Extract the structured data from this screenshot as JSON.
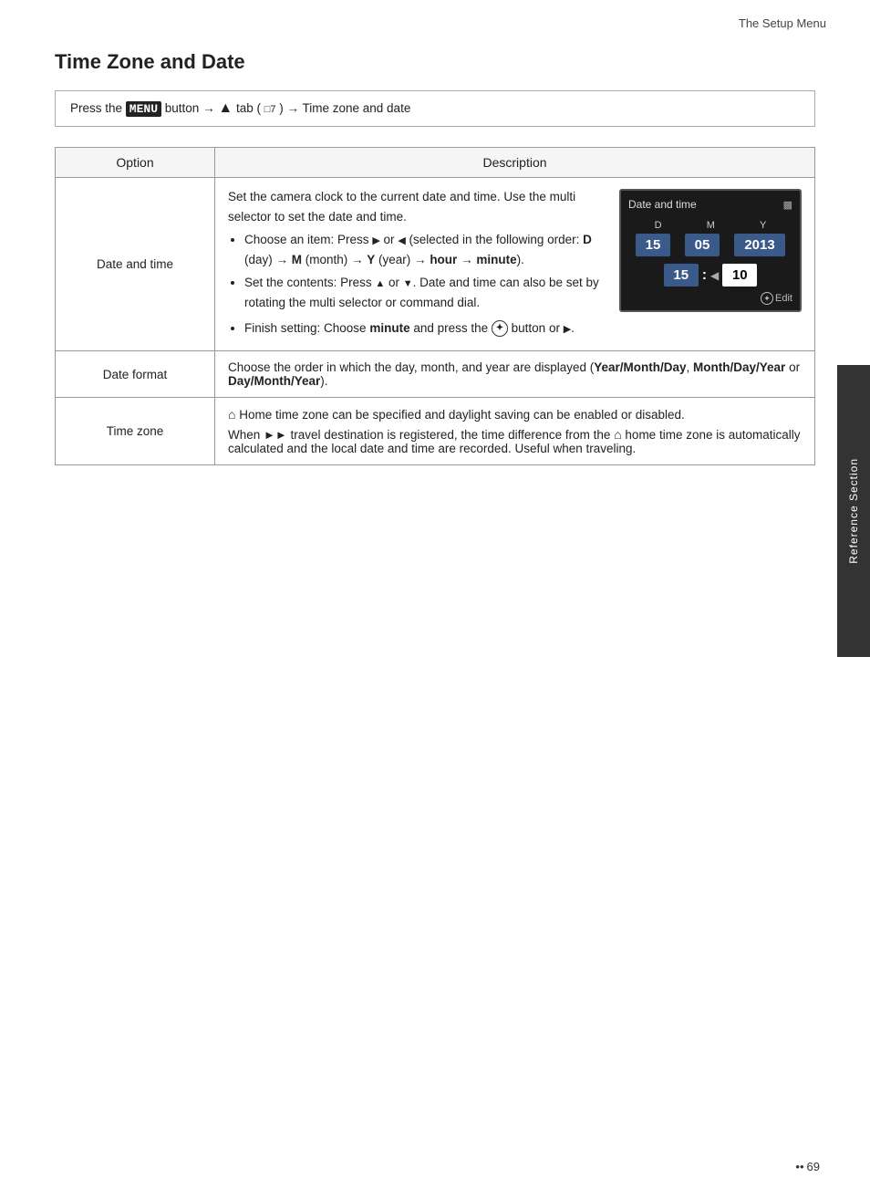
{
  "header": {
    "title": "The Setup Menu"
  },
  "page_title": "Time Zone and Date",
  "nav_instruction": {
    "prefix": "Press the",
    "menu_key": "MENU",
    "middle": "button → ",
    "tab_symbol": "♦",
    "tab_text": " tab (",
    "page_ref": "□7",
    "suffix": ") → Time zone and date"
  },
  "table": {
    "headers": [
      "Option",
      "Description"
    ],
    "rows": [
      {
        "option": "Date and time",
        "description": {
          "intro": "Set the camera clock to the current date and time. Use the multi selector to set the date and time.",
          "bullets": [
            "Choose an item: Press ▶ or ◀ (selected in the following order: D (day) → M (month) → Y (year) → hour → minute).",
            "Set the contents: Press ▲ or ▼. Date and time can also be set by rotating the multi selector or command dial.",
            "Finish setting: Choose minute and press the ⊛ button or ▶."
          ],
          "screen": {
            "title": "Date and time",
            "labels": [
              "D",
              "M",
              "Y"
            ],
            "values": [
              "15",
              "05",
              "2013"
            ],
            "time": [
              "15",
              "10"
            ],
            "edit_label": "Edit"
          }
        }
      },
      {
        "option": "Date format",
        "description": "Choose the order in which the day, month, and year are displayed (Year/Month/Day, Month/Day/Year or Day/Month/Year)."
      },
      {
        "option": "Time zone",
        "description": "🏠 Home time zone can be specified and daylight saving can be enabled or disabled.\nWhen ➤ travel destination is registered, the time difference from the 🏠 home time zone is automatically calculated and the local date and time are recorded. Useful when traveling."
      }
    ]
  },
  "sidebar": {
    "label": "Reference Section"
  },
  "page_number": "69"
}
